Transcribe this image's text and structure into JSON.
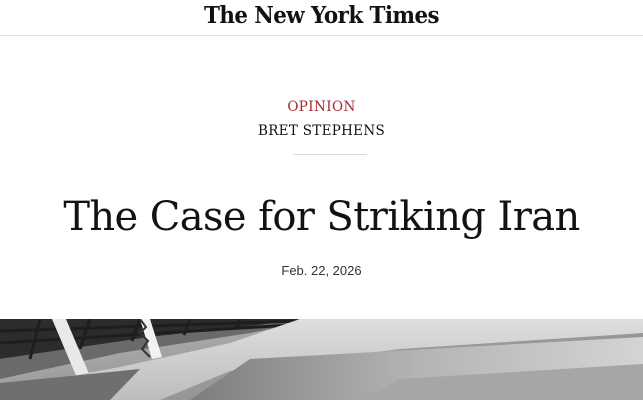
{
  "masthead": {
    "logo_text": "The New York Times"
  },
  "article": {
    "section": "OPINION",
    "byline": "BRET STEPHENS",
    "headline": "The Case for Striking Iran",
    "date": "Feb. 22, 2026"
  },
  "lead_image": {
    "description_icon": "photo"
  }
}
